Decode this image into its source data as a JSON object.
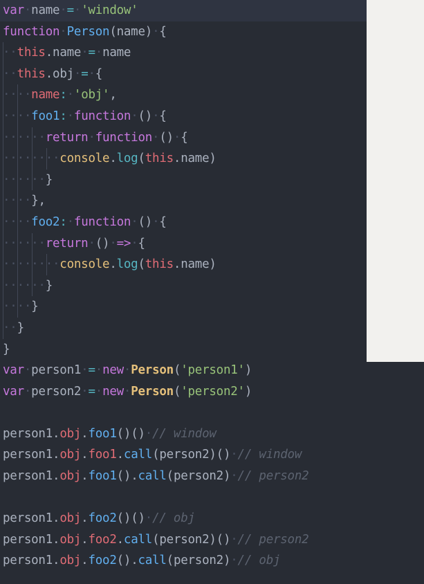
{
  "editor": {
    "theme_name": "one-dark",
    "background": "#282c34",
    "active_line_background": "#2f3441",
    "default_text_color": "#abb2bf",
    "indent_guide_color": "#4b5263",
    "overlay_panel_color": "#f2f1ee",
    "language": "javascript",
    "font_size_px": 17.5,
    "line_height_px": 30.6,
    "active_line_index": 0,
    "palette": {
      "keyword": "#c678dd",
      "function": "#61afef",
      "constructor": "#e5c07b",
      "string": "#98c379",
      "operator": "#56b6c2",
      "identifier": "#abb2bf",
      "property": "#e06c75",
      "object": "#e5c07b",
      "method": "#56b6c2",
      "comment": "#5c6370"
    }
  },
  "code": {
    "plain_text": "var name = 'window'\nfunction Person(name) {\n  this.name = name\n  this.obj = {\n    name: 'obj',\n    foo1: function () {\n      return function () {\n        console.log(this.name)\n      }\n    },\n    foo2: function () {\n      return () => {\n        console.log(this.name)\n      }\n    }\n  }\n}\nvar person1 = new Person('person1')\nvar person2 = new Person('person2')\n\nperson1.obj.foo1()() // window\nperson1.obj.foo1.call(person2)() // window\nperson1.obj.foo1().call(person2) // person2\n\nperson1.obj.foo2()() // obj\nperson1.obj.foo2.call(person2)() // person2\nperson1.obj.foo2().call(person2) // obj",
    "lines": [
      {
        "n": 1,
        "indent": 0,
        "text": "var name = 'window'"
      },
      {
        "n": 2,
        "indent": 0,
        "text": "function Person(name) {"
      },
      {
        "n": 3,
        "indent": 1,
        "text": "this.name = name"
      },
      {
        "n": 4,
        "indent": 1,
        "text": "this.obj = {"
      },
      {
        "n": 5,
        "indent": 2,
        "text": "name: 'obj',"
      },
      {
        "n": 6,
        "indent": 2,
        "text": "foo1: function () {"
      },
      {
        "n": 7,
        "indent": 3,
        "text": "return function () {"
      },
      {
        "n": 8,
        "indent": 4,
        "text": "console.log(this.name)"
      },
      {
        "n": 9,
        "indent": 3,
        "text": "}"
      },
      {
        "n": 10,
        "indent": 2,
        "text": "},"
      },
      {
        "n": 11,
        "indent": 2,
        "text": "foo2: function () {"
      },
      {
        "n": 12,
        "indent": 3,
        "text": "return () => {"
      },
      {
        "n": 13,
        "indent": 4,
        "text": "console.log(this.name)"
      },
      {
        "n": 14,
        "indent": 3,
        "text": "}"
      },
      {
        "n": 15,
        "indent": 2,
        "text": "}"
      },
      {
        "n": 16,
        "indent": 1,
        "text": "}"
      },
      {
        "n": 17,
        "indent": 0,
        "text": "}"
      },
      {
        "n": 18,
        "indent": 0,
        "text": "var person1 = new Person('person1')"
      },
      {
        "n": 19,
        "indent": 0,
        "text": "var person2 = new Person('person2')"
      },
      {
        "n": 20,
        "indent": 0,
        "text": ""
      },
      {
        "n": 21,
        "indent": 0,
        "text": "person1.obj.foo1()() // window"
      },
      {
        "n": 22,
        "indent": 0,
        "text": "person1.obj.foo1.call(person2)() // window"
      },
      {
        "n": 23,
        "indent": 0,
        "text": "person1.obj.foo1().call(person2) // person2"
      },
      {
        "n": 24,
        "indent": 0,
        "text": ""
      },
      {
        "n": 25,
        "indent": 0,
        "text": "person1.obj.foo2()() // obj"
      },
      {
        "n": 26,
        "indent": 0,
        "text": "person1.obj.foo2.call(person2)() // person2"
      },
      {
        "n": 27,
        "indent": 0,
        "text": "person1.obj.foo2().call(person2) // obj"
      }
    ],
    "comments": [
      {
        "line": 21,
        "text": "// window"
      },
      {
        "line": 22,
        "text": "// window"
      },
      {
        "line": 23,
        "text": "// person2"
      },
      {
        "line": 25,
        "text": "// obj"
      },
      {
        "line": 26,
        "text": "// person2"
      },
      {
        "line": 27,
        "text": "// obj"
      }
    ],
    "strings": [
      "'window'",
      "'obj'",
      "'person1'",
      "'person2'"
    ],
    "identifiers": [
      "name",
      "Person",
      "this",
      "obj",
      "foo1",
      "foo2",
      "console",
      "log",
      "person1",
      "person2",
      "call"
    ],
    "keywords": [
      "var",
      "function",
      "return",
      "new"
    ]
  },
  "tokens": {
    "l1": [
      [
        "var",
        "kw"
      ],
      [
        " ",
        "ws"
      ],
      [
        "name",
        "ident"
      ],
      [
        " ",
        "ws"
      ],
      [
        "=",
        "op"
      ],
      [
        " ",
        "ws"
      ],
      [
        "'window'",
        "str"
      ]
    ],
    "l2": [
      [
        "function",
        "kw"
      ],
      [
        " ",
        "ws"
      ],
      [
        "Person",
        "fnname"
      ],
      [
        "(",
        "punc"
      ],
      [
        "name",
        "ident"
      ],
      [
        ")",
        "punc"
      ],
      [
        " ",
        "ws"
      ],
      [
        "{",
        "punc"
      ]
    ],
    "l3": [
      [
        "this",
        "prop"
      ],
      [
        ".",
        "punc"
      ],
      [
        "name",
        "ident"
      ],
      [
        " ",
        "ws"
      ],
      [
        "=",
        "op"
      ],
      [
        " ",
        "ws"
      ],
      [
        "name",
        "ident"
      ]
    ],
    "l4": [
      [
        "this",
        "prop"
      ],
      [
        ".",
        "punc"
      ],
      [
        "obj",
        "ident"
      ],
      [
        " ",
        "ws"
      ],
      [
        "=",
        "op"
      ],
      [
        " ",
        "ws"
      ],
      [
        "{",
        "punc"
      ]
    ],
    "l5": [
      [
        "name",
        "key"
      ],
      [
        ":",
        "method"
      ],
      [
        " ",
        "ws"
      ],
      [
        "'obj'",
        "str"
      ],
      [
        ",",
        "punc"
      ]
    ],
    "l6": [
      [
        "foo1",
        "fnname"
      ],
      [
        ":",
        "method"
      ],
      [
        " ",
        "ws"
      ],
      [
        "function",
        "kw"
      ],
      [
        " ",
        "ws"
      ],
      [
        "()",
        "punc"
      ],
      [
        " ",
        "ws"
      ],
      [
        "{",
        "punc"
      ]
    ],
    "l7": [
      [
        "return",
        "kw"
      ],
      [
        " ",
        "ws"
      ],
      [
        "function",
        "kw"
      ],
      [
        " ",
        "ws"
      ],
      [
        "()",
        "punc"
      ],
      [
        " ",
        "ws"
      ],
      [
        "{",
        "punc"
      ]
    ],
    "l8": [
      [
        "console",
        "objname"
      ],
      [
        ".",
        "punc"
      ],
      [
        "log",
        "method"
      ],
      [
        "(",
        "punc"
      ],
      [
        "this",
        "prop"
      ],
      [
        ".",
        "punc"
      ],
      [
        "name",
        "ident"
      ],
      [
        ")",
        "punc"
      ]
    ],
    "l9": [
      [
        "}",
        "punc"
      ]
    ],
    "l10": [
      [
        "}",
        "punc"
      ],
      [
        ",",
        "punc"
      ]
    ],
    "l11": [
      [
        "foo2",
        "fnname"
      ],
      [
        ":",
        "method"
      ],
      [
        " ",
        "ws"
      ],
      [
        "function",
        "kw"
      ],
      [
        " ",
        "ws"
      ],
      [
        "()",
        "punc"
      ],
      [
        " ",
        "ws"
      ],
      [
        "{",
        "punc"
      ]
    ],
    "l12": [
      [
        "return",
        "kw"
      ],
      [
        " ",
        "ws"
      ],
      [
        "()",
        "punc"
      ],
      [
        " ",
        "ws"
      ],
      [
        "=>",
        "kw"
      ],
      [
        " ",
        "ws"
      ],
      [
        "{",
        "punc"
      ]
    ],
    "l13": [
      [
        "console",
        "objname"
      ],
      [
        ".",
        "punc"
      ],
      [
        "log",
        "method"
      ],
      [
        "(",
        "punc"
      ],
      [
        "this",
        "prop"
      ],
      [
        ".",
        "punc"
      ],
      [
        "name",
        "ident"
      ],
      [
        ")",
        "punc"
      ]
    ],
    "l14": [
      [
        "}",
        "punc"
      ]
    ],
    "l15": [
      [
        "}",
        "punc"
      ]
    ],
    "l16": [
      [
        "}",
        "punc"
      ]
    ],
    "l17": [
      [
        "}",
        "punc"
      ]
    ],
    "l18": [
      [
        "var",
        "kw"
      ],
      [
        " ",
        "ws"
      ],
      [
        "person1",
        "ident"
      ],
      [
        " ",
        "ws"
      ],
      [
        "=",
        "op"
      ],
      [
        " ",
        "ws"
      ],
      [
        "new",
        "kw"
      ],
      [
        " ",
        "ws"
      ],
      [
        "Person",
        "ctor"
      ],
      [
        "(",
        "punc"
      ],
      [
        "'person1'",
        "str"
      ],
      [
        ")",
        "punc"
      ]
    ],
    "l19": [
      [
        "var",
        "kw"
      ],
      [
        " ",
        "ws"
      ],
      [
        "person2",
        "ident"
      ],
      [
        " ",
        "ws"
      ],
      [
        "=",
        "op"
      ],
      [
        " ",
        "ws"
      ],
      [
        "new",
        "kw"
      ],
      [
        " ",
        "ws"
      ],
      [
        "Person",
        "ctor"
      ],
      [
        "(",
        "punc"
      ],
      [
        "'person2'",
        "str"
      ],
      [
        ")",
        "punc"
      ]
    ],
    "l21": [
      [
        "person1",
        "ident"
      ],
      [
        ".",
        "punc"
      ],
      [
        "obj",
        "prop"
      ],
      [
        ".",
        "punc"
      ],
      [
        "foo1",
        "fnname"
      ],
      [
        "()()",
        "punc"
      ],
      [
        " ",
        "ws"
      ],
      [
        "// window",
        "comment"
      ]
    ],
    "l22": [
      [
        "person1",
        "ident"
      ],
      [
        ".",
        "punc"
      ],
      [
        "obj",
        "prop"
      ],
      [
        ".",
        "punc"
      ],
      [
        "foo1",
        "prop"
      ],
      [
        ".",
        "punc"
      ],
      [
        "call",
        "fnname"
      ],
      [
        "(",
        "punc"
      ],
      [
        "person2",
        "ident"
      ],
      [
        ")()",
        "punc"
      ],
      [
        " ",
        "ws"
      ],
      [
        "// window",
        "comment"
      ]
    ],
    "l23": [
      [
        "person1",
        "ident"
      ],
      [
        ".",
        "punc"
      ],
      [
        "obj",
        "prop"
      ],
      [
        ".",
        "punc"
      ],
      [
        "foo1",
        "fnname"
      ],
      [
        "().",
        "punc"
      ],
      [
        "call",
        "fnname"
      ],
      [
        "(",
        "punc"
      ],
      [
        "person2",
        "ident"
      ],
      [
        ")",
        "punc"
      ],
      [
        " ",
        "ws"
      ],
      [
        "// person2",
        "comment"
      ]
    ],
    "l25": [
      [
        "person1",
        "ident"
      ],
      [
        ".",
        "punc"
      ],
      [
        "obj",
        "prop"
      ],
      [
        ".",
        "punc"
      ],
      [
        "foo2",
        "fnname"
      ],
      [
        "()()",
        "punc"
      ],
      [
        " ",
        "ws"
      ],
      [
        "// obj",
        "comment"
      ]
    ],
    "l26": [
      [
        "person1",
        "ident"
      ],
      [
        ".",
        "punc"
      ],
      [
        "obj",
        "prop"
      ],
      [
        ".",
        "punc"
      ],
      [
        "foo2",
        "prop"
      ],
      [
        ".",
        "punc"
      ],
      [
        "call",
        "fnname"
      ],
      [
        "(",
        "punc"
      ],
      [
        "person2",
        "ident"
      ],
      [
        ")()",
        "punc"
      ],
      [
        " ",
        "ws"
      ],
      [
        "// person2",
        "comment"
      ]
    ],
    "l27": [
      [
        "person1",
        "ident"
      ],
      [
        ".",
        "punc"
      ],
      [
        "obj",
        "prop"
      ],
      [
        ".",
        "punc"
      ],
      [
        "foo2",
        "fnname"
      ],
      [
        "().",
        "punc"
      ],
      [
        "call",
        "fnname"
      ],
      [
        "(",
        "punc"
      ],
      [
        "person2",
        "ident"
      ],
      [
        ")",
        "punc"
      ],
      [
        " ",
        "ws"
      ],
      [
        "// obj",
        "comment"
      ]
    ]
  }
}
